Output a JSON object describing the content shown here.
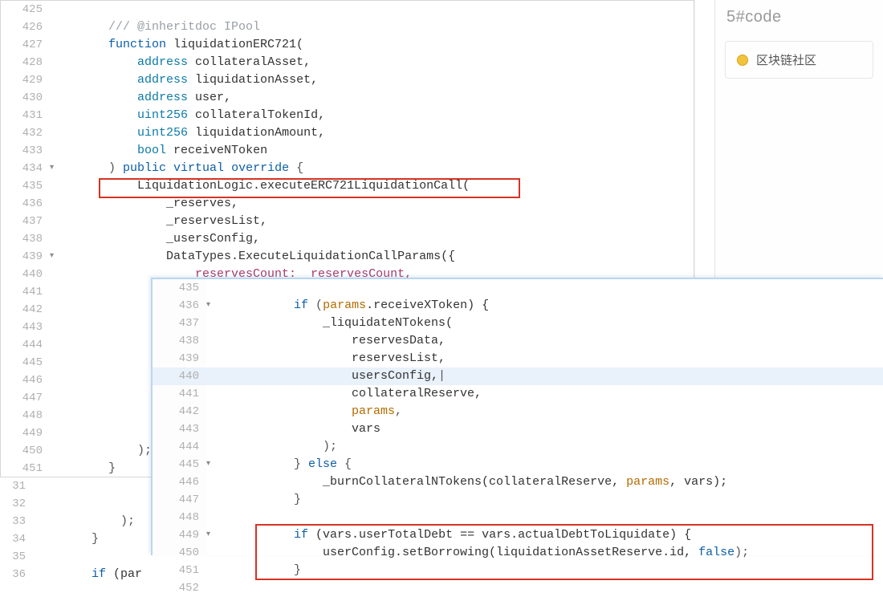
{
  "right": {
    "head_fragment": "5#code",
    "community_label": "区块链社区"
  },
  "back_editor": {
    "lines": [
      {
        "n": "425",
        "fold": false,
        "cls": "",
        "tokens": []
      },
      {
        "n": "426",
        "fold": false,
        "cls": "",
        "tokens": [
          {
            "t": "        ",
            "c": ""
          },
          {
            "t": "/// @inheritdoc IPool",
            "c": "comment"
          }
        ]
      },
      {
        "n": "427",
        "fold": false,
        "cls": "",
        "tokens": [
          {
            "t": "        ",
            "c": ""
          },
          {
            "t": "function",
            "c": "kw"
          },
          {
            "t": " liquidationERC721(",
            "c": "ident"
          }
        ]
      },
      {
        "n": "428",
        "fold": false,
        "cls": "",
        "tokens": [
          {
            "t": "            ",
            "c": ""
          },
          {
            "t": "address",
            "c": "type"
          },
          {
            "t": " collateralAsset,",
            "c": "ident"
          }
        ]
      },
      {
        "n": "429",
        "fold": false,
        "cls": "",
        "tokens": [
          {
            "t": "            ",
            "c": ""
          },
          {
            "t": "address",
            "c": "type"
          },
          {
            "t": " liquidationAsset,",
            "c": "ident"
          }
        ]
      },
      {
        "n": "430",
        "fold": false,
        "cls": "",
        "tokens": [
          {
            "t": "            ",
            "c": ""
          },
          {
            "t": "address",
            "c": "type"
          },
          {
            "t": " user,",
            "c": "ident"
          }
        ]
      },
      {
        "n": "431",
        "fold": false,
        "cls": "",
        "tokens": [
          {
            "t": "            ",
            "c": ""
          },
          {
            "t": "uint256",
            "c": "type"
          },
          {
            "t": " collateralTokenId,",
            "c": "ident"
          }
        ]
      },
      {
        "n": "432",
        "fold": false,
        "cls": "",
        "tokens": [
          {
            "t": "            ",
            "c": ""
          },
          {
            "t": "uint256",
            "c": "type"
          },
          {
            "t": " liquidationAmount,",
            "c": "ident"
          }
        ]
      },
      {
        "n": "433",
        "fold": false,
        "cls": "",
        "tokens": [
          {
            "t": "            ",
            "c": ""
          },
          {
            "t": "bool",
            "c": "type"
          },
          {
            "t": " receiveNToken",
            "c": "ident"
          }
        ]
      },
      {
        "n": "434",
        "fold": true,
        "cls": "",
        "tokens": [
          {
            "t": "        ) ",
            "c": "punct"
          },
          {
            "t": "public",
            "c": "kw"
          },
          {
            "t": " ",
            "c": ""
          },
          {
            "t": "virtual",
            "c": "kw"
          },
          {
            "t": " ",
            "c": ""
          },
          {
            "t": "override",
            "c": "kw"
          },
          {
            "t": " {",
            "c": "punct"
          }
        ]
      },
      {
        "n": "435",
        "fold": false,
        "cls": "",
        "tokens": [
          {
            "t": "            LiquidationLogic.executeERC721LiquidationCall(",
            "c": "ident"
          }
        ]
      },
      {
        "n": "436",
        "fold": false,
        "cls": "",
        "tokens": [
          {
            "t": "                _reserves,",
            "c": "ident"
          }
        ]
      },
      {
        "n": "437",
        "fold": false,
        "cls": "",
        "tokens": [
          {
            "t": "                _reservesList,",
            "c": "ident"
          }
        ]
      },
      {
        "n": "438",
        "fold": false,
        "cls": "",
        "tokens": [
          {
            "t": "                _usersConfig,",
            "c": "ident"
          }
        ]
      },
      {
        "n": "439",
        "fold": true,
        "cls": "",
        "tokens": [
          {
            "t": "                DataTypes.ExecuteLiquidationCallParams({",
            "c": "ident"
          }
        ]
      },
      {
        "n": "440",
        "fold": false,
        "cls": "",
        "tokens": [
          {
            "t": "                    ",
            "c": ""
          },
          {
            "t": "reservesCount:  reservesCount,",
            "c": "prop"
          }
        ]
      },
      {
        "n": "441",
        "fold": false,
        "cls": "",
        "tokens": []
      },
      {
        "n": "442",
        "fold": false,
        "cls": "",
        "tokens": []
      },
      {
        "n": "443",
        "fold": false,
        "cls": "",
        "tokens": []
      },
      {
        "n": "444",
        "fold": false,
        "cls": "",
        "tokens": []
      },
      {
        "n": "445",
        "fold": false,
        "cls": "",
        "tokens": []
      },
      {
        "n": "446",
        "fold": false,
        "cls": "",
        "tokens": []
      },
      {
        "n": "447",
        "fold": false,
        "cls": "",
        "tokens": []
      },
      {
        "n": "448",
        "fold": false,
        "cls": "",
        "tokens": []
      },
      {
        "n": "449",
        "fold": false,
        "cls": "",
        "tokens": [
          {
            "t": "                }",
            "c": "punct"
          }
        ]
      },
      {
        "n": "450",
        "fold": false,
        "cls": "",
        "tokens": [
          {
            "t": "            );",
            "c": "punct"
          }
        ]
      },
      {
        "n": "451",
        "fold": false,
        "cls": "",
        "tokens": [
          {
            "t": "        }",
            "c": "punct"
          }
        ]
      }
    ]
  },
  "strip_editor": {
    "lines": [
      {
        "n": "31",
        "tokens": []
      },
      {
        "n": "32",
        "tokens": []
      },
      {
        "n": "33",
        "tokens": [
          {
            "t": "            );",
            "c": "punct"
          }
        ]
      },
      {
        "n": "34",
        "tokens": [
          {
            "t": "        }",
            "c": "punct"
          }
        ]
      },
      {
        "n": "35",
        "tokens": []
      },
      {
        "n": "36",
        "tokens": [
          {
            "t": "        ",
            "c": ""
          },
          {
            "t": "if",
            "c": "kw"
          },
          {
            "t": " (par",
            "c": "ident"
          }
        ]
      }
    ]
  },
  "overlay_editor": {
    "lines": [
      {
        "n": "435",
        "fold": false,
        "cls": "",
        "tokens": []
      },
      {
        "n": "436",
        "fold": true,
        "cls": "",
        "tokens": [
          {
            "t": "            ",
            "c": ""
          },
          {
            "t": "if",
            "c": "kw"
          },
          {
            "t": " (",
            "c": "punct"
          },
          {
            "t": "params",
            "c": "param"
          },
          {
            "t": ".receiveXToken) {",
            "c": "ident"
          }
        ]
      },
      {
        "n": "437",
        "fold": false,
        "cls": "",
        "tokens": [
          {
            "t": "                _liquidateNTokens(",
            "c": "ident"
          }
        ]
      },
      {
        "n": "438",
        "fold": false,
        "cls": "",
        "tokens": [
          {
            "t": "                    reservesData,",
            "c": "ident"
          }
        ]
      },
      {
        "n": "439",
        "fold": false,
        "cls": "",
        "tokens": [
          {
            "t": "                    reservesList,",
            "c": "ident"
          }
        ]
      },
      {
        "n": "440",
        "fold": false,
        "cls": "cursor-line",
        "tokens": [
          {
            "t": "                    usersConfig,",
            "c": "ident"
          },
          {
            "t": "|",
            "c": "punct"
          }
        ]
      },
      {
        "n": "441",
        "fold": false,
        "cls": "",
        "tokens": [
          {
            "t": "                    collateralReserve,",
            "c": "ident"
          }
        ]
      },
      {
        "n": "442",
        "fold": false,
        "cls": "",
        "tokens": [
          {
            "t": "                    ",
            "c": ""
          },
          {
            "t": "params",
            "c": "param"
          },
          {
            "t": ",",
            "c": "punct"
          }
        ]
      },
      {
        "n": "443",
        "fold": false,
        "cls": "",
        "tokens": [
          {
            "t": "                    vars",
            "c": "ident"
          }
        ]
      },
      {
        "n": "444",
        "fold": false,
        "cls": "",
        "tokens": [
          {
            "t": "                );",
            "c": "punct"
          }
        ]
      },
      {
        "n": "445",
        "fold": true,
        "cls": "",
        "tokens": [
          {
            "t": "            } ",
            "c": "punct"
          },
          {
            "t": "else",
            "c": "kw"
          },
          {
            "t": " {",
            "c": "punct"
          }
        ]
      },
      {
        "n": "446",
        "fold": false,
        "cls": "",
        "tokens": [
          {
            "t": "                _burnCollateralNTokens(collateralReserve, ",
            "c": "ident"
          },
          {
            "t": "params",
            "c": "param"
          },
          {
            "t": ", vars);",
            "c": "ident"
          }
        ]
      },
      {
        "n": "447",
        "fold": false,
        "cls": "",
        "tokens": [
          {
            "t": "            }",
            "c": "punct"
          }
        ]
      },
      {
        "n": "448",
        "fold": false,
        "cls": "",
        "tokens": []
      },
      {
        "n": "449",
        "fold": true,
        "cls": "",
        "tokens": [
          {
            "t": "            ",
            "c": ""
          },
          {
            "t": "if",
            "c": "kw"
          },
          {
            "t": " (vars.userTotalDebt == vars.actualDebtToLiquidate) {",
            "c": "ident"
          }
        ]
      },
      {
        "n": "450",
        "fold": false,
        "cls": "",
        "tokens": [
          {
            "t": "                userConfig.setBorrowing(liquidationAssetReserve.id, ",
            "c": "ident"
          },
          {
            "t": "false",
            "c": "kw"
          },
          {
            "t": ");",
            "c": "punct"
          }
        ]
      },
      {
        "n": "451",
        "fold": false,
        "cls": "",
        "tokens": [
          {
            "t": "            }",
            "c": "punct"
          }
        ]
      },
      {
        "n": "452",
        "fold": false,
        "cls": "",
        "tokens": []
      }
    ]
  }
}
